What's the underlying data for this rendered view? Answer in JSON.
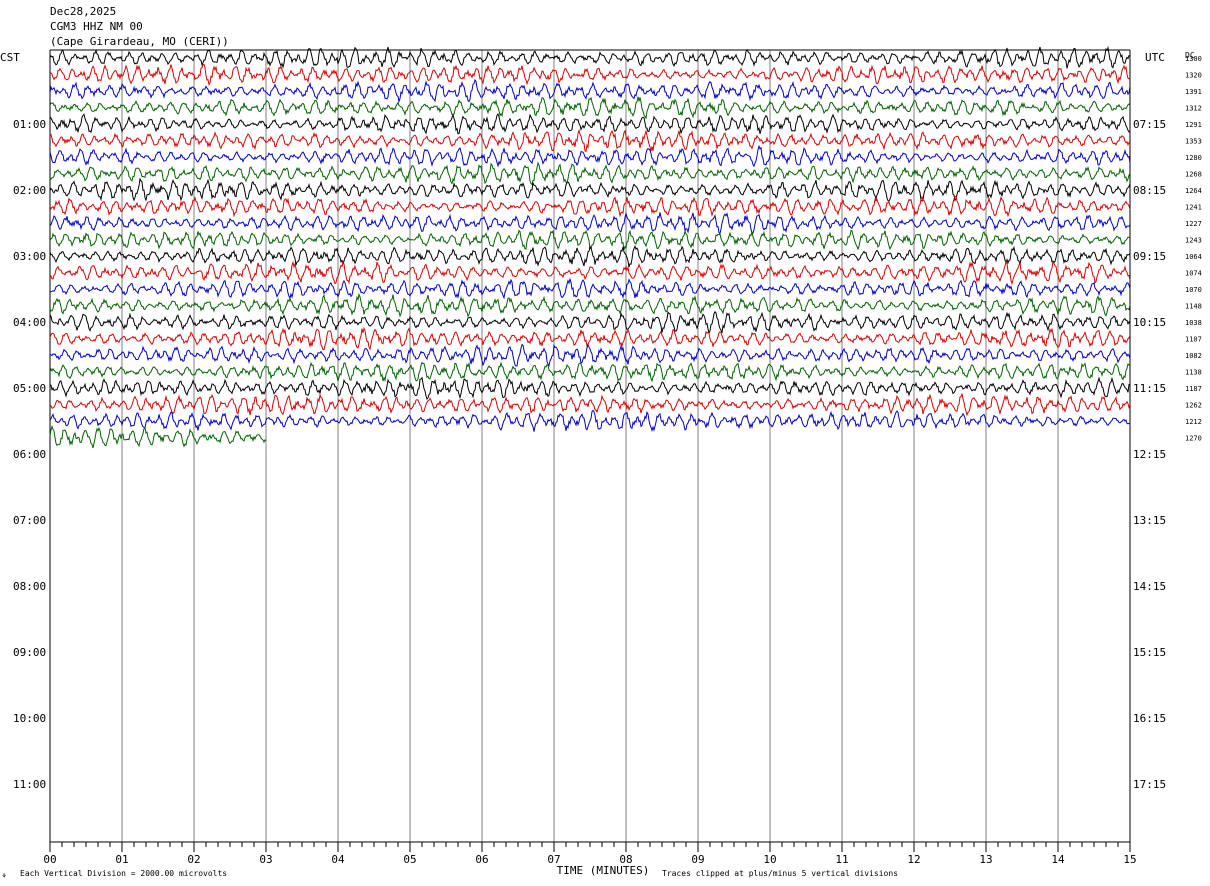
{
  "header": {
    "date": "Dec28,2025",
    "station": "CGM3 HHZ NM 00",
    "location": "(Cape Girardeau, MO (CERI))"
  },
  "left_zone_label": "CST",
  "right_zone_label": "UTC",
  "dc_label": "DC",
  "footer": {
    "vertical_division": "Each Vertical Division = 2000.00 microvolts",
    "clip_note": "Traces clipped at plus/minus 5 vertical divisions"
  },
  "chart_data": {
    "type": "line",
    "xlabel": "TIME (MINUTES)",
    "xlim": [
      0,
      15
    ],
    "x_ticks": [
      "00",
      "01",
      "02",
      "03",
      "04",
      "05",
      "06",
      "07",
      "08",
      "09",
      "10",
      "11",
      "12",
      "13",
      "14",
      "15"
    ],
    "rows_per_hour": 4,
    "row_count": 48,
    "left_hour_labels": [
      "01:00",
      "02:00",
      "03:00",
      "04:00",
      "05:00",
      "06:00",
      "07:00",
      "08:00",
      "09:00",
      "10:00",
      "11:00"
    ],
    "right_hour_labels": [
      "07:15",
      "08:15",
      "09:15",
      "10:15",
      "11:15",
      "12:15",
      "13:15",
      "14:15",
      "15:15",
      "16:15",
      "17:15"
    ],
    "trace_colors": [
      "#000000",
      "#e00000",
      "#0000cc",
      "#006400"
    ],
    "dc_offsets": [
      1300,
      1320,
      1391,
      1312,
      1291,
      1353,
      1280,
      1268,
      1264,
      1241,
      1227,
      1243,
      1064,
      1074,
      1070,
      1148,
      1038,
      1107,
      1082,
      1138,
      1187,
      1262,
      1212,
      1270
    ],
    "recorded_traces": 24,
    "last_trace_minutes": 3,
    "vertical_division_microvolts": 2000,
    "clip_divisions": 5
  }
}
